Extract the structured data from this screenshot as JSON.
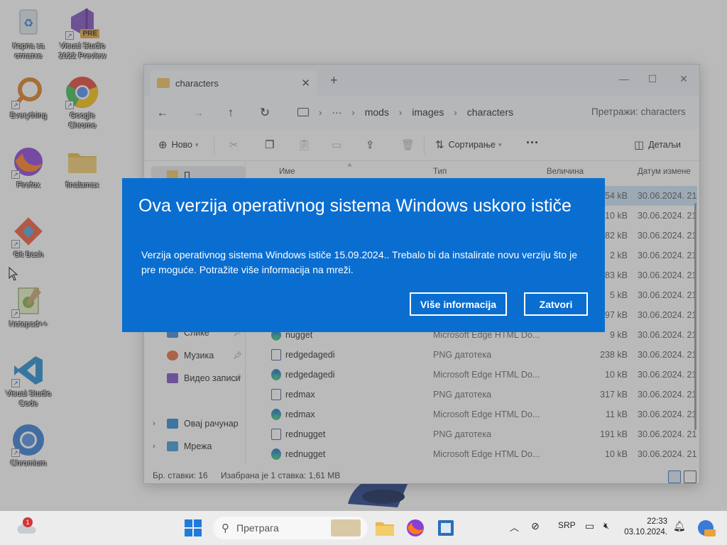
{
  "desktop": {
    "icons": [
      {
        "label": "Корпа за отпатке"
      },
      {
        "label": "Visual Studio 2022 Preview"
      },
      {
        "label": "Everything"
      },
      {
        "label": "Google Chrome"
      },
      {
        "label": "Firefox"
      },
      {
        "label": "finalamax"
      },
      {
        "label": "Git Bash"
      },
      {
        "label": "Notepad++"
      },
      {
        "label": "Visual Studio Code"
      },
      {
        "label": "Chromium"
      }
    ],
    "vs_badge": "PRE"
  },
  "explorer": {
    "tab_title": "characters",
    "new_tab": "+",
    "breadcrumb": [
      "···",
      "mods",
      "images",
      "characters"
    ],
    "search_placeholder": "Претражи: characters",
    "commands": {
      "new": "Ново",
      "sort": "Сортирање",
      "more": "···",
      "details": "Детаљи"
    },
    "columns": {
      "name": "Име",
      "type": "Тип",
      "size": "Величина",
      "date": "Датум измене"
    },
    "nav_items": [
      {
        "label": "П",
        "pinned": false
      },
      {
        "label": "Слике",
        "pinned": true
      },
      {
        "label": "Музика",
        "pinned": true
      },
      {
        "label": "Видео записи",
        "pinned": true
      },
      {
        "label": "Овај рачунар",
        "pinned": false
      },
      {
        "label": "Мрежа",
        "pinned": false
      }
    ],
    "files": [
      {
        "name": "",
        "type": "",
        "size": "54 kB",
        "date": "30.06.2024. 21",
        "icon": "png",
        "selected": true
      },
      {
        "name": "",
        "type": "",
        "size": "10 kB",
        "date": "30.06.2024. 21",
        "icon": "edge",
        "selected": false
      },
      {
        "name": "",
        "type": "",
        "size": "82 kB",
        "date": "30.06.2024. 21",
        "icon": "png",
        "selected": false
      },
      {
        "name": "",
        "type": "",
        "size": "2 kB",
        "date": "30.06.2024. 21",
        "icon": "edge",
        "selected": false
      },
      {
        "name": "",
        "type": "",
        "size": "83 kB",
        "date": "30.06.2024. 21",
        "icon": "png",
        "selected": false
      },
      {
        "name": "",
        "type": "",
        "size": "5 kB",
        "date": "30.06.2024. 21",
        "icon": "edge",
        "selected": false
      },
      {
        "name": "",
        "type": "",
        "size": "97 kB",
        "date": "30.06.2024. 21",
        "icon": "png",
        "selected": false
      },
      {
        "name": "nugget",
        "type": "Microsoft Edge HTML Do...",
        "size": "9 kB",
        "date": "30.06.2024. 21",
        "icon": "edge",
        "selected": false
      },
      {
        "name": "redgedagedi",
        "type": "PNG датотека",
        "size": "238 kB",
        "date": "30.06.2024. 21",
        "icon": "png",
        "selected": false
      },
      {
        "name": "redgedagedi",
        "type": "Microsoft Edge HTML Do...",
        "size": "10 kB",
        "date": "30.06.2024. 21",
        "icon": "edge",
        "selected": false
      },
      {
        "name": "redmax",
        "type": "PNG датотека",
        "size": "317 kB",
        "date": "30.06.2024. 21",
        "icon": "png",
        "selected": false
      },
      {
        "name": "redmax",
        "type": "Microsoft Edge HTML Do...",
        "size": "11 kB",
        "date": "30.06.2024. 21",
        "icon": "edge",
        "selected": false
      },
      {
        "name": "rednugget",
        "type": "PNG датотека",
        "size": "191 kB",
        "date": "30.06.2024. 21",
        "icon": "png",
        "selected": false
      },
      {
        "name": "rednugget",
        "type": "Microsoft Edge HTML Do...",
        "size": "10 kB",
        "date": "30.06.2024. 21",
        "icon": "edge",
        "selected": false
      }
    ],
    "status": {
      "count": "Бр. ставки: 16",
      "selection": "Изабрана је 1 ставка: 1,61 MB"
    }
  },
  "dialog": {
    "title": "Ova verzija operativnog sistema Windows uskoro ističe",
    "body": "Verzija operativnog sistema Windows ističe 15.09.2024.. Trebalo bi da instalirate novu verziju što je pre moguće. Potražite više informacija na mreži.",
    "more_info_label": "Više informacija",
    "close_label": "Zatvori",
    "bg_color": "#0a6ed1"
  },
  "taskbar": {
    "search_placeholder": "Претрага",
    "notification_count": "1",
    "language": "SRP",
    "time": "22:33",
    "date": "03.10.2024."
  }
}
